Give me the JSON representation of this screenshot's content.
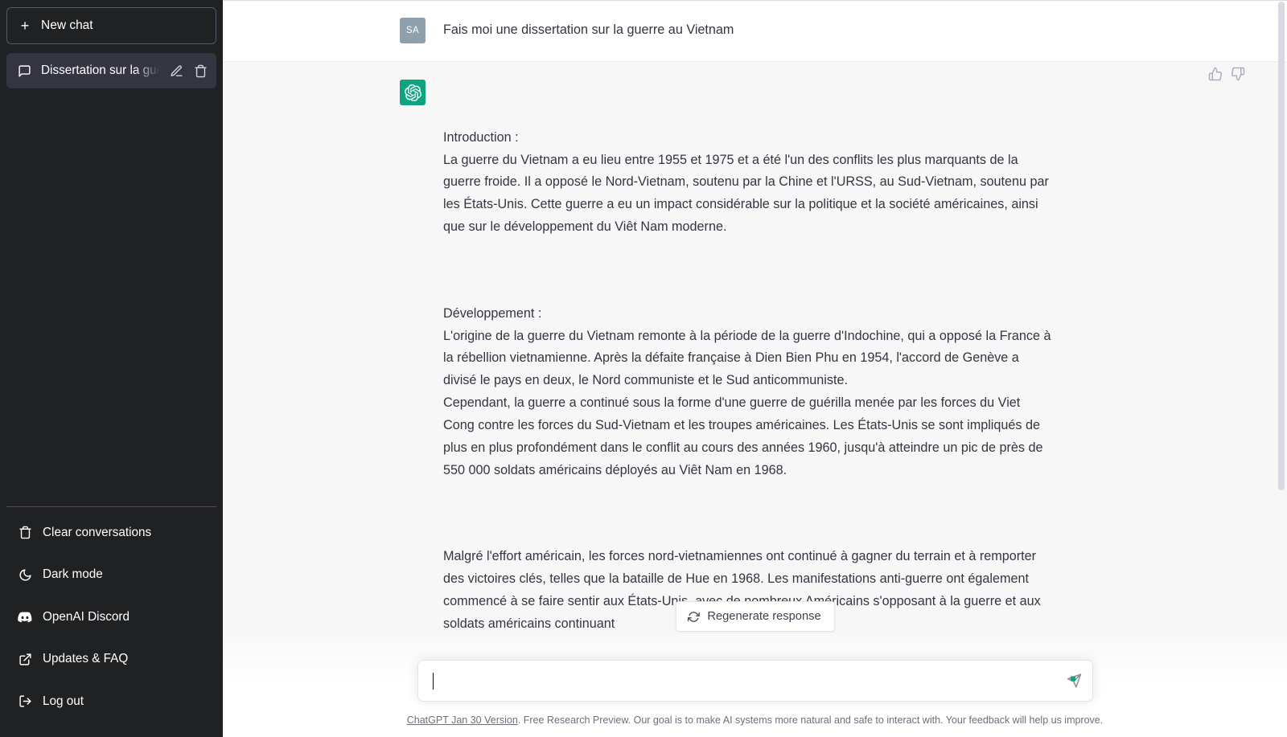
{
  "sidebar": {
    "new_chat_label": "New chat",
    "conversations": [
      {
        "title": "Dissertation sur la guerre au Vietnam",
        "active": true
      }
    ],
    "footer_items": [
      {
        "label": "Clear conversations",
        "icon": "trash-icon"
      },
      {
        "label": "Dark mode",
        "icon": "moon-icon"
      },
      {
        "label": "OpenAI Discord",
        "icon": "discord-icon"
      },
      {
        "label": "Updates & FAQ",
        "icon": "external-link-icon"
      },
      {
        "label": "Log out",
        "icon": "logout-icon"
      }
    ]
  },
  "conversation": {
    "user_message": {
      "avatar_initials": "SA",
      "text": "Fais moi une dissertation sur la guerre au Vietnam"
    },
    "assistant_message": {
      "paragraphs": [
        "Introduction :\nLa guerre du Vietnam a eu lieu entre 1955 et 1975 et a été l'un des conflits les plus marquants de la guerre froide. Il a opposé le Nord-Vietnam, soutenu par la Chine et l'URSS, au Sud-Vietnam, soutenu par les États-Unis. Cette guerre a eu un impact considérable sur la politique et la société américaines, ainsi que sur le développement du Viêt Nam moderne.",
        "Développement :\nL'origine de la guerre du Vietnam remonte à la période de la guerre d'Indochine, qui a opposé la France à la rébellion vietnamienne. Après la défaite française à Dien Bien Phu en 1954, l'accord de Genève a divisé le pays en deux, le Nord communiste et le Sud anticommuniste.\nCependant, la guerre a continué sous la forme d'une guerre de guérilla menée par les forces du Viet Cong contre les forces du Sud-Vietnam et les troupes américaines. Les États-Unis se sont impliqués de plus en plus profondément dans le conflit au cours des années 1960, jusqu'à atteindre un pic de près de 550 000 soldats américains déployés au Viêt Nam en 1968.",
        "Malgré l'effort américain, les forces nord-vietnamiennes ont continué à gagner du terrain et à remporter des victoires clés, telles que la bataille de Hue en 1968. Les manifestations anti-guerre ont également commencé à se faire sentir aux États-Unis, avec de nombreux Américains s'opposant à la guerre et aux soldats américains continuant"
      ]
    }
  },
  "actions": {
    "thumbs_up": "thumbs-up-icon",
    "thumbs_down": "thumbs-down-icon",
    "regenerate_label": "Regenerate response"
  },
  "composer": {
    "value": "",
    "placeholder": ""
  },
  "footer": {
    "version_link": "ChatGPT Jan 30 Version",
    "disclaimer": ". Free Research Preview. Our goal is to make AI systems more natural and safe to interact with. Your feedback will help us improve."
  },
  "colors": {
    "accent": "#10a37f",
    "sidebar_bg": "#202123",
    "bot_bubble_bg": "#f7f7f8",
    "user_avatar_bg": "#8ea0ab"
  }
}
